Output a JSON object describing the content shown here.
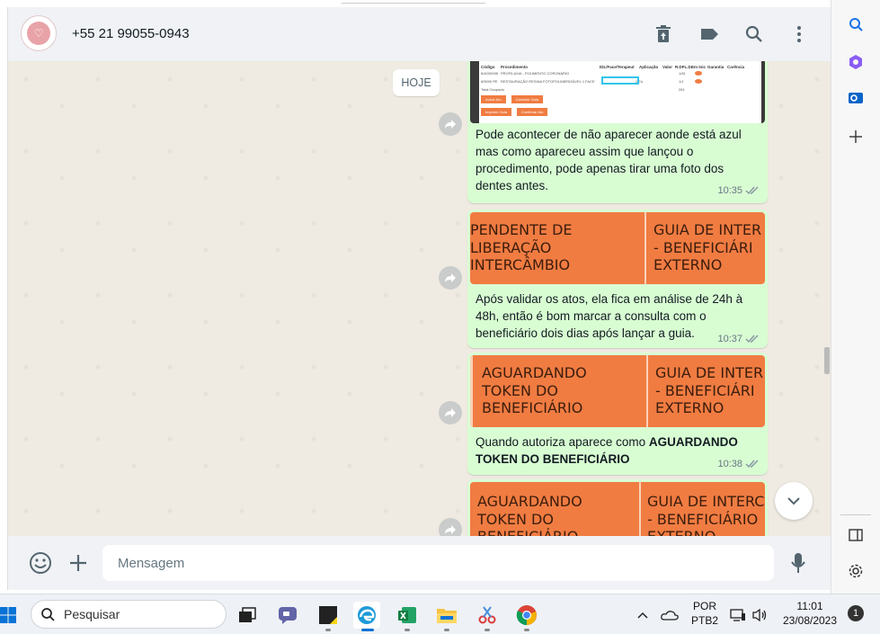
{
  "header": {
    "contact": "+55 21 99055-0943"
  },
  "chat": {
    "day_chip": "HOJE",
    "messages": [
      {
        "caption": "Pode acontecer de não aparecer aonde está azul mas como apareceu assim que lançou o procedimento, pode apenas tirar uma foto dos dentes antes.",
        "time": "10:35"
      },
      {
        "col1": "PENDENTE DE\nLIBERAÇÃO\nINTERCÂMBIO",
        "col2": "GUIA DE INTER\n- BENEFICIÁRI\nEXTERNO",
        "caption": "Após validar os atos, ela fica em análise de 24h à 48h, então é bom marcar a consulta com o beneficiário dois dias após lançar a guia.",
        "time": "10:37"
      },
      {
        "col1": "AGUARDANDO\nTOKEN DO\nBENEFICIÁRIO",
        "col2": "GUIA DE INTER\n- BENEFICIÁRI\nEXTERNO",
        "caption_prefix": "Quando autoriza aparece como ",
        "caption_bold": "AGUARDANDO TOKEN DO BENEFICIÁRIO",
        "time": "10:38"
      },
      {
        "col1": "AGUARDANDO\nTOKEN DO\nBENEFICIÁRIO",
        "col2": "GUIA DE INTERC\n- BENEFICIÁRIO\nEXTERNO"
      }
    ],
    "screenshot_table": {
      "headers": [
        "Código",
        "Procedimento",
        "IDL/Face/Terapeut",
        "Aplicação",
        "Valor",
        "R.DFL.D.",
        "Em Inic",
        "Garantia",
        "Carência"
      ],
      "rows": [
        [
          "8/4000098",
          "PROFILAXIA - POLIMENTO CORONÁRIO",
          "",
          "",
          "",
          "1/81",
          "",
          "",
          ""
        ],
        [
          "8/5000 PE",
          "RESTAURAÇÃO RESINA FOTOPOLIMERIZÁVEL 1 FACE",
          "",
          "CEU",
          "",
          "1/1",
          "",
          "",
          ""
        ]
      ],
      "total_label": "Total Ocupado",
      "total_value": "281",
      "buttons": [
        "Incluir Ato",
        "Cancelar Guia",
        "Imprimir Guia",
        "Confirmar Ato"
      ]
    }
  },
  "composer": {
    "placeholder": "Mensagem"
  },
  "taskbar": {
    "search": "Pesquisar",
    "lang_top": "POR",
    "lang_bottom": "PTB2",
    "time": "11:01",
    "date": "23/08/2023",
    "notifications": "1"
  },
  "colors": {
    "bubble": "#d9fdd3",
    "tag_orange": "#f07c42",
    "panel": "#f0f2f5"
  },
  "icons": [
    "delete-icon",
    "label-icon",
    "search-icon",
    "menu-icon",
    "forward-icon",
    "emoji-icon",
    "plus-icon",
    "mic-icon",
    "chevron-down-icon",
    "windows-start-icon",
    "copilot-icon",
    "onedrive-icon",
    "wifi-icon",
    "volume-icon"
  ]
}
